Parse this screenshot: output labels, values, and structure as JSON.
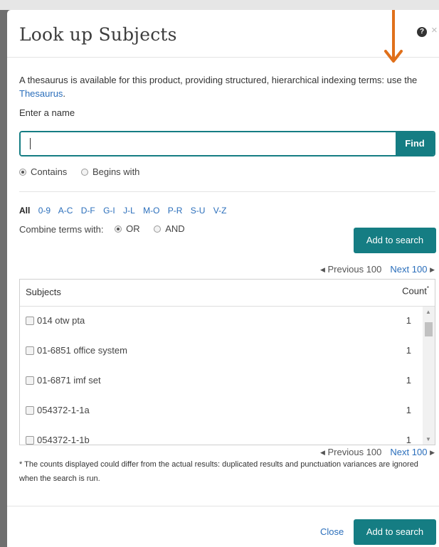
{
  "dialog": {
    "title": "Look up Subjects",
    "help_glyph": "?",
    "close_glyph": "×",
    "intro_text": "A thesaurus is available for this product, providing structured, hierarchical indexing terms: use the ",
    "thesaurus_link": "Thesaurus",
    "intro_end": ".",
    "name_label": "Enter a name"
  },
  "search": {
    "value": "",
    "placeholder": "",
    "find_label": "Find",
    "match_options": [
      {
        "label": "Contains",
        "selected": true
      },
      {
        "label": "Begins with",
        "selected": false
      }
    ]
  },
  "alphabet": {
    "all_label": "All",
    "ranges": [
      "0-9",
      "A-C",
      "D-F",
      "G-I",
      "J-L",
      "M-O",
      "P-R",
      "S-U",
      "V-Z"
    ]
  },
  "combine": {
    "label": "Combine terms with:",
    "options": [
      {
        "label": "OR",
        "selected": true
      },
      {
        "label": "AND",
        "selected": false
      }
    ]
  },
  "add_to_search_label": "Add to search",
  "pager": {
    "prev_label": "Previous 100",
    "next_label": "Next 100",
    "prev_glyph": "◀",
    "next_glyph": "▶"
  },
  "table": {
    "headers": {
      "subject": "Subjects",
      "count": "Count",
      "count_mark": "*"
    },
    "rows": [
      {
        "name": "014 otw pta",
        "count": "1"
      },
      {
        "name": "01-6851 office system",
        "count": "1"
      },
      {
        "name": "01-6871 imf set",
        "count": "1"
      },
      {
        "name": "054372-1-1a",
        "count": "1"
      },
      {
        "name": "054372-1-1b",
        "count": "1"
      }
    ],
    "scroll_up_glyph": "▲",
    "scroll_down_glyph": "▼"
  },
  "footnote": "* The counts displayed could differ from the actual results: duplicated results and punctuation variances are ignored when the search is run.",
  "footer": {
    "close_label": "Close",
    "add_label": "Add to search"
  },
  "colors": {
    "accent": "#157d83",
    "link": "#2a6ebb",
    "annotation_arrow": "#e0701b",
    "backdrop": "#6f6f6f"
  }
}
